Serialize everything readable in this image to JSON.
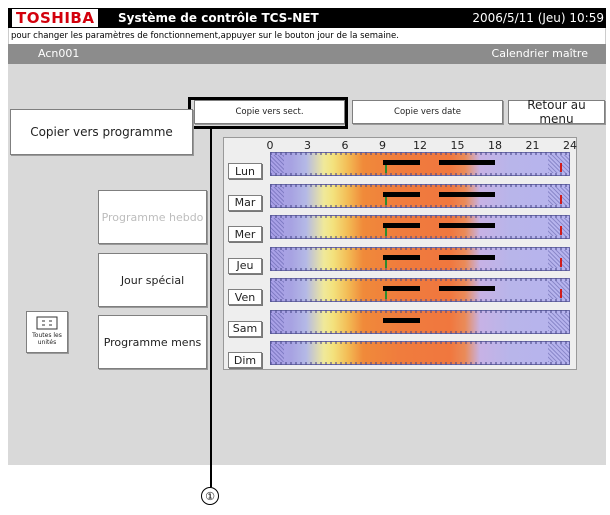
{
  "titlebar": {
    "logo": "TOSHIBA",
    "title": "Système de contrôle TCS-NET",
    "datetime": "2006/5/11 (Jeu)  10:59"
  },
  "instruction": "pour changer les paramètres de fonctionnement,appuyer sur le bouton jour de la semaine.",
  "header": {
    "address": "Acn001",
    "screen_name": "Calendrier maître"
  },
  "toolbar": {
    "copy_to_section": "Copie vers sect.",
    "copy_to_date": "Copie vers date",
    "back_to_menu": "Retour au menu"
  },
  "left": {
    "copy_to_program": "Copier vers programme",
    "weekly_program": "Programme hebdo",
    "special_day": "Jour spécial",
    "monthly_program": "Programme mens",
    "all_units_line1": "Toutes les",
    "all_units_line2": "unités"
  },
  "calendar": {
    "hour_ticks": [
      "0",
      "3",
      "6",
      "9",
      "12",
      "15",
      "18",
      "21",
      "24"
    ],
    "days": [
      {
        "label": "Lun",
        "schedules": [
          [
            9,
            12
          ],
          [
            13.5,
            18
          ]
        ],
        "green_marker": 9.2,
        "red_marker": 23.2
      },
      {
        "label": "Mar",
        "schedules": [
          [
            9,
            12
          ],
          [
            13.5,
            18
          ]
        ],
        "green_marker": 9.2,
        "red_marker": 23.2
      },
      {
        "label": "Mer",
        "schedules": [
          [
            9,
            12
          ],
          [
            13.5,
            18
          ]
        ],
        "green_marker": 9.2,
        "red_marker": 23.2
      },
      {
        "label": "Jeu",
        "schedules": [
          [
            9,
            12
          ],
          [
            13.5,
            18
          ]
        ],
        "green_marker": 9.2,
        "red_marker": 23.2
      },
      {
        "label": "Ven",
        "schedules": [
          [
            9,
            12
          ],
          [
            13.5,
            18
          ]
        ],
        "green_marker": 9.2,
        "red_marker": 23.2
      },
      {
        "label": "Sam",
        "schedules": [
          [
            9,
            12
          ]
        ],
        "green_marker": null,
        "red_marker": null
      },
      {
        "label": "Dim",
        "schedules": [],
        "green_marker": null,
        "red_marker": null
      }
    ]
  },
  "callout": {
    "number": "①"
  },
  "colors": {
    "brand_red": "#d3000c",
    "titlebar": "#000000",
    "header_gray": "#8c8c8c",
    "panel_gray": "#d9d9d9",
    "schedule_bar": "#000000",
    "marker_green": "#2e8b2e",
    "marker_red": "#d01c1c"
  }
}
